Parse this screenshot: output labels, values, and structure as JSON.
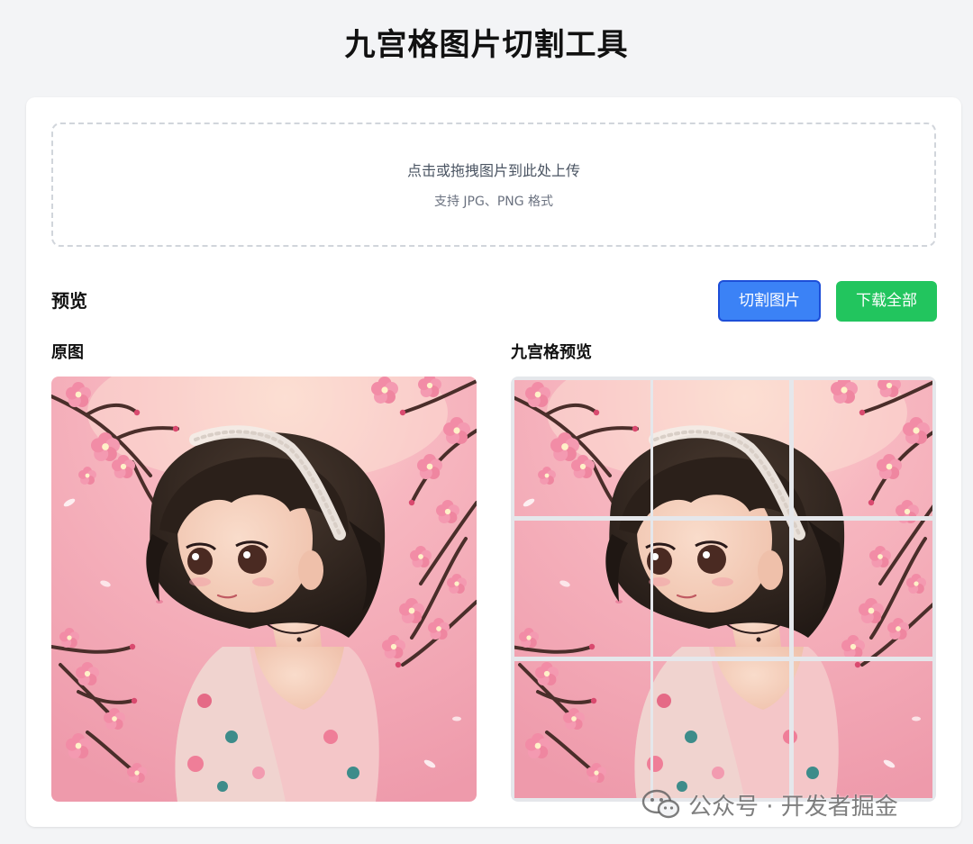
{
  "page": {
    "title": "九宫格图片切割工具"
  },
  "upload": {
    "main_text": "点击或拖拽图片到此处上传",
    "sub_text": "支持 JPG、PNG 格式"
  },
  "preview": {
    "heading": "预览",
    "original_label": "原图",
    "grid_label": "九宫格预览",
    "grid_rows": 3,
    "grid_cols": 3
  },
  "actions": {
    "cut_label": "切割图片",
    "download_label": "下载全部"
  },
  "watermark": {
    "text": "公众号 · 开发者掘金",
    "icon": "wechat-icon"
  },
  "colors": {
    "cut_button": "#3b82f6",
    "download_button": "#22c55e",
    "background": "#f3f4f6"
  }
}
